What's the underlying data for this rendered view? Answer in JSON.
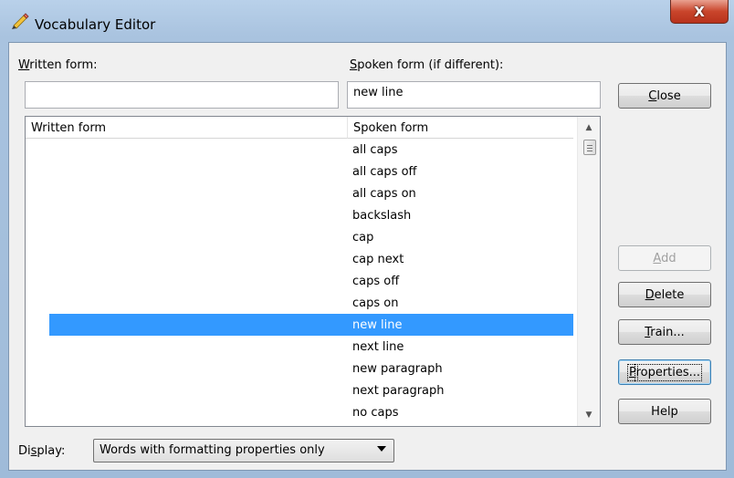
{
  "window": {
    "title": "Vocabulary Editor",
    "close_glyph": "X"
  },
  "form": {
    "written_label": "Written form:",
    "spoken_label": "Spoken form (if different):",
    "written_value": "",
    "spoken_value": "new line"
  },
  "list": {
    "columns": [
      "Written form",
      "Spoken form"
    ],
    "rows": [
      {
        "written": "",
        "spoken": "all caps",
        "selected": false
      },
      {
        "written": "",
        "spoken": "all caps off",
        "selected": false
      },
      {
        "written": "",
        "spoken": "all caps on",
        "selected": false
      },
      {
        "written": "",
        "spoken": "backslash",
        "selected": false
      },
      {
        "written": "",
        "spoken": "cap",
        "selected": false
      },
      {
        "written": "",
        "spoken": "cap next",
        "selected": false
      },
      {
        "written": "",
        "spoken": "caps off",
        "selected": false
      },
      {
        "written": "",
        "spoken": "caps on",
        "selected": false
      },
      {
        "written": "",
        "spoken": "new line",
        "selected": true
      },
      {
        "written": "",
        "spoken": "next line",
        "selected": false
      },
      {
        "written": "",
        "spoken": "new paragraph",
        "selected": false
      },
      {
        "written": "",
        "spoken": "next paragraph",
        "selected": false
      },
      {
        "written": "",
        "spoken": "no caps",
        "selected": false
      }
    ]
  },
  "buttons": {
    "close": "Close",
    "add": "Add",
    "delete": "Delete",
    "train": "Train...",
    "properties": "Properties...",
    "help": "Help"
  },
  "display": {
    "label": "Display:",
    "selected": "Words with formatting properties only"
  },
  "icons": {
    "title_icon": "pencil-icon",
    "scroll_up": "arrow-up-icon",
    "scroll_down": "arrow-down-icon",
    "dropdown": "chevron-down-icon"
  },
  "colors": {
    "selection": "#3399ff",
    "window_frame": "#b9d1ea",
    "close_button": "#c9452b"
  }
}
